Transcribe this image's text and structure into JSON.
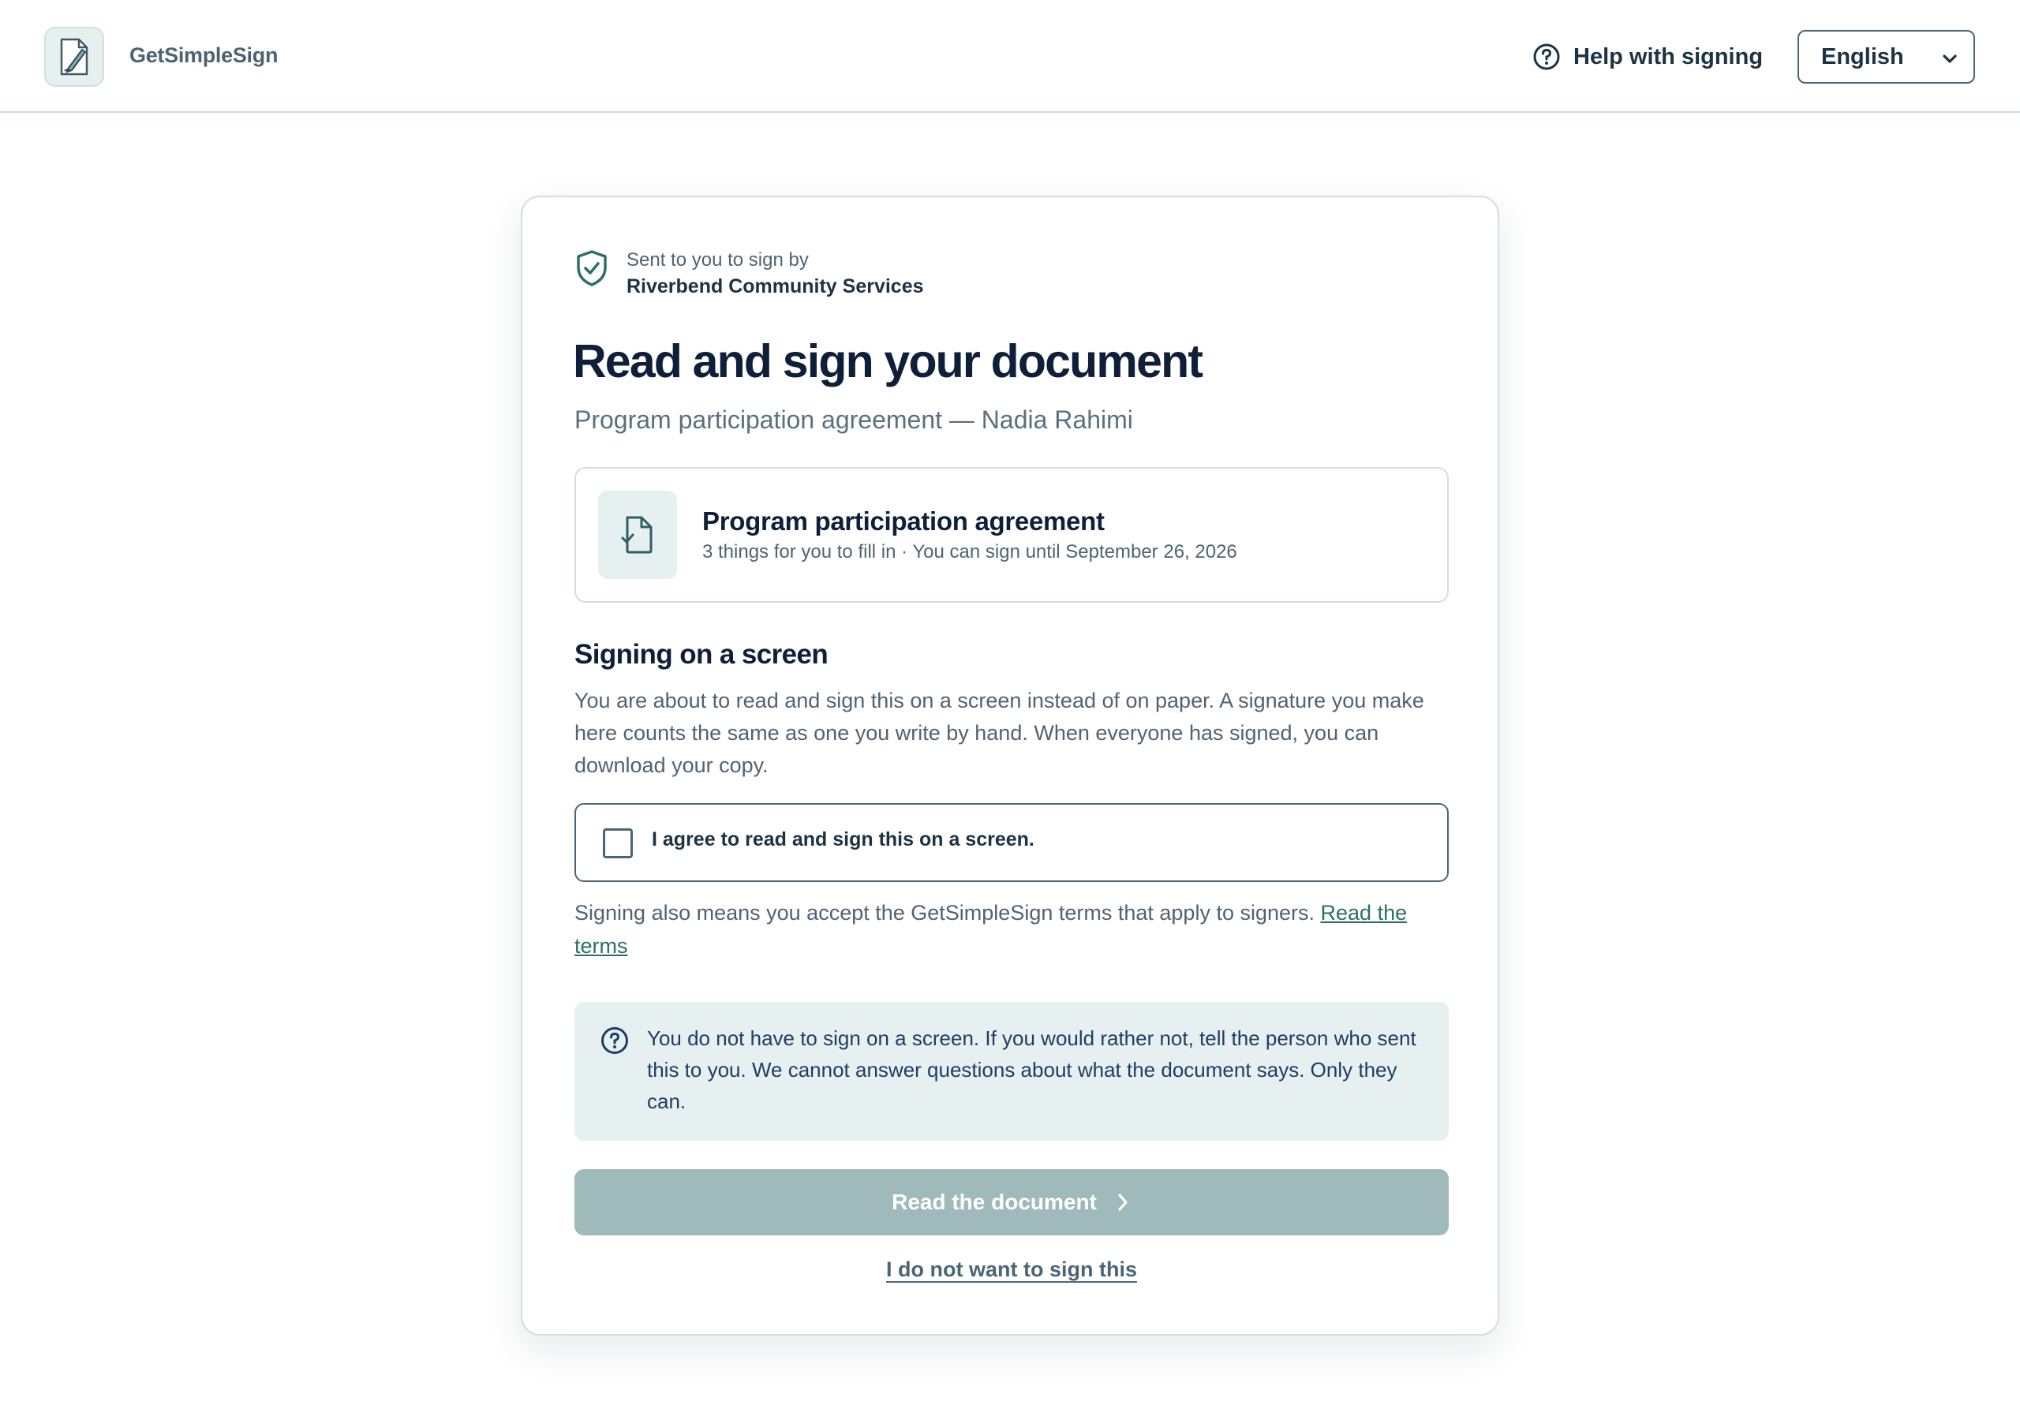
{
  "header": {
    "brand": "GetSimpleSign",
    "logo_icon": "pen-document-icon",
    "help_label": "Help with signing",
    "help_icon": "question-circle-icon",
    "language": "English"
  },
  "sender": {
    "icon": "shield-check-icon",
    "label": "Sent to you to sign by",
    "org": "Riverbend Community Services"
  },
  "page": {
    "title": "Read and sign your document",
    "subtitle": "Program participation agreement — Nadia Rahimi"
  },
  "document": {
    "icon": "document-check-icon",
    "title": "Program participation agreement",
    "meta": "3 things for you to fill in · You can sign until September 26, 2026"
  },
  "consent": {
    "heading": "Signing on a screen",
    "body": "You are about to read and sign this on a screen instead of on paper. A signature you make here counts the same as one you write by hand. When everyone has signed, you can download your copy.",
    "agree_label": "I agree to read and sign this on a screen.",
    "agree_checked": false,
    "terms_text": "Signing also means you accept the GetSimpleSign terms that apply to signers. ",
    "terms_link": "Read the terms"
  },
  "info": {
    "icon": "question-circle-icon",
    "text": "You do not have to sign on a screen. If you would rather not, tell the person who sent this to you. We cannot answer questions about what the document says. Only they can."
  },
  "actions": {
    "primary_label": "Read the document",
    "primary_icon": "chevron-right-icon",
    "decline_label": "I do not want to sign this"
  },
  "colors": {
    "accent": "#2d6f6a",
    "primary_disabled": "#a0b9ba",
    "info_bg": "#e6f0f1",
    "heading": "#0f1f3a"
  }
}
